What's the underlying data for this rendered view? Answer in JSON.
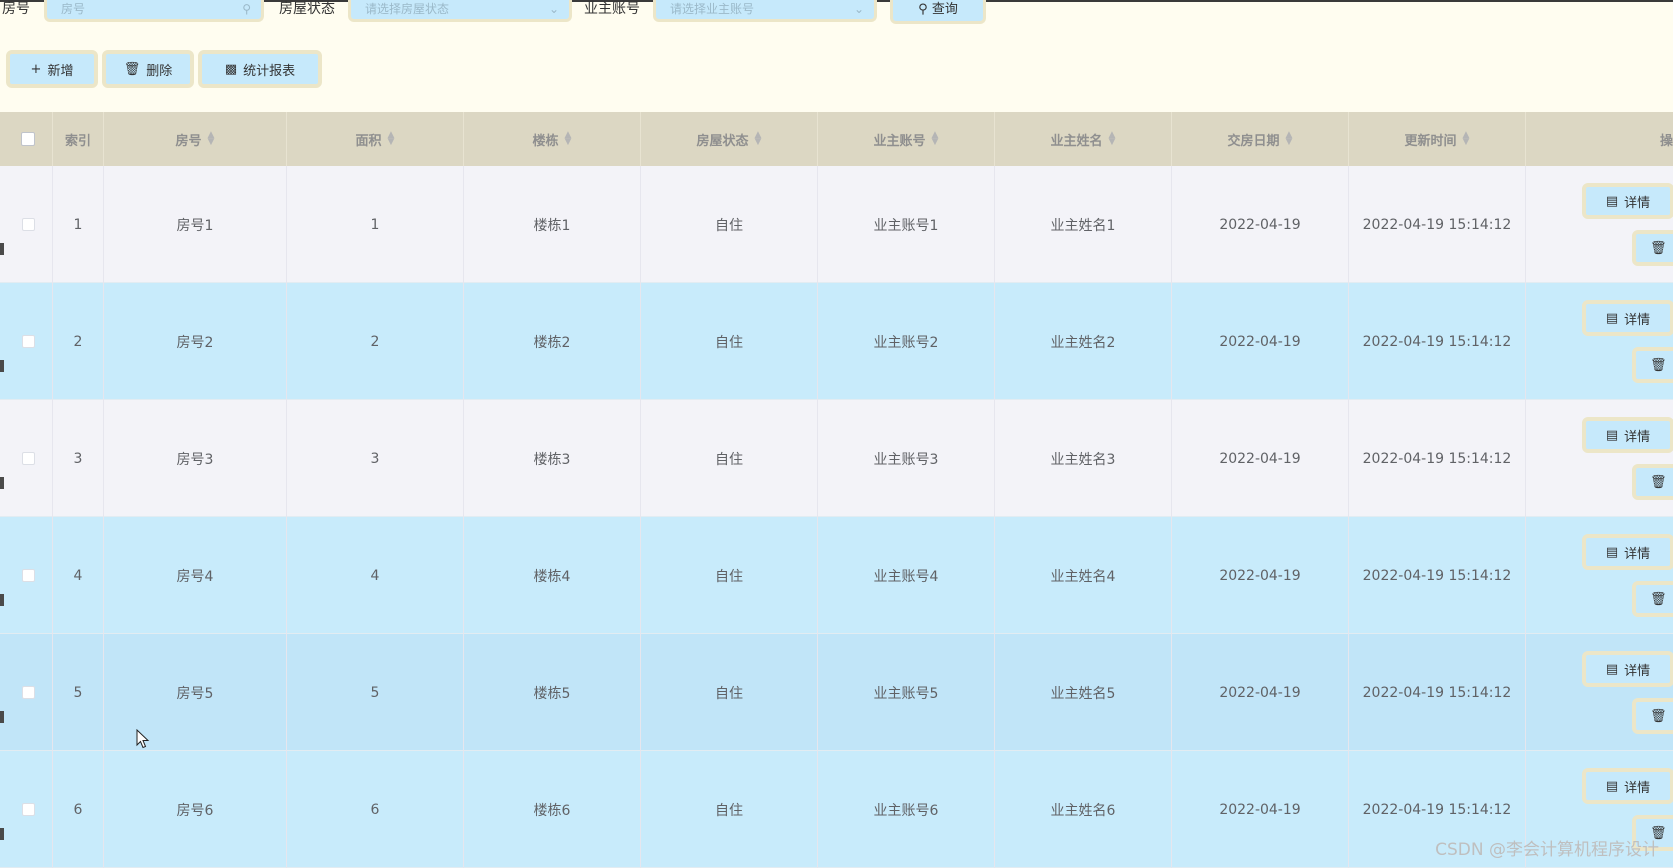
{
  "filters": {
    "room_label": "房号",
    "room_placeholder": "房号",
    "status_label": "房屋状态",
    "status_placeholder": "请选择房屋状态",
    "owner_label": "业主账号",
    "owner_placeholder": "请选择业主账号",
    "query_label": "查询"
  },
  "actions": {
    "add_label": "新增",
    "delete_label": "删除",
    "report_label": "统计报表"
  },
  "table": {
    "headers": {
      "index": "索引",
      "room": "房号",
      "area": "面积",
      "building": "楼栋",
      "status": "房屋状态",
      "owner_account": "业主账号",
      "owner_name": "业主姓名",
      "handover_date": "交房日期",
      "update_time": "更新时间",
      "operation": "操"
    },
    "rows": [
      {
        "index": "1",
        "room": "房号1",
        "area": "1",
        "building": "楼栋1",
        "status": "自住",
        "owner_account": "业主账号1",
        "owner_name": "业主姓名1",
        "handover_date": "2022-04-19",
        "update_time": "2022-04-19 15:14:12"
      },
      {
        "index": "2",
        "room": "房号2",
        "area": "2",
        "building": "楼栋2",
        "status": "自住",
        "owner_account": "业主账号2",
        "owner_name": "业主姓名2",
        "handover_date": "2022-04-19",
        "update_time": "2022-04-19 15:14:12"
      },
      {
        "index": "3",
        "room": "房号3",
        "area": "3",
        "building": "楼栋3",
        "status": "自住",
        "owner_account": "业主账号3",
        "owner_name": "业主姓名3",
        "handover_date": "2022-04-19",
        "update_time": "2022-04-19 15:14:12"
      },
      {
        "index": "4",
        "room": "房号4",
        "area": "4",
        "building": "楼栋4",
        "status": "自住",
        "owner_account": "业主账号4",
        "owner_name": "业主姓名4",
        "handover_date": "2022-04-19",
        "update_time": "2022-04-19 15:14:12"
      },
      {
        "index": "5",
        "room": "房号5",
        "area": "5",
        "building": "楼栋5",
        "status": "自住",
        "owner_account": "业主账号5",
        "owner_name": "业主姓名5",
        "handover_date": "2022-04-19",
        "update_time": "2022-04-19 15:14:12"
      },
      {
        "index": "6",
        "room": "房号6",
        "area": "6",
        "building": "楼栋6",
        "status": "自住",
        "owner_account": "业主账号6",
        "owner_name": "业主姓名6",
        "handover_date": "2022-04-19",
        "update_time": "2022-04-19 15:14:12"
      }
    ],
    "detail_label": "详情"
  },
  "watermark": "CSDN @李会计算机程序设计",
  "colors": {
    "page_bg": "#fffdf0",
    "button_bg": "#c6e9fb",
    "button_border": "#ece6c8",
    "header_bg": "#dcd7c3",
    "row_odd": "#f3f3f8",
    "row_even": "#c8ebfb"
  }
}
